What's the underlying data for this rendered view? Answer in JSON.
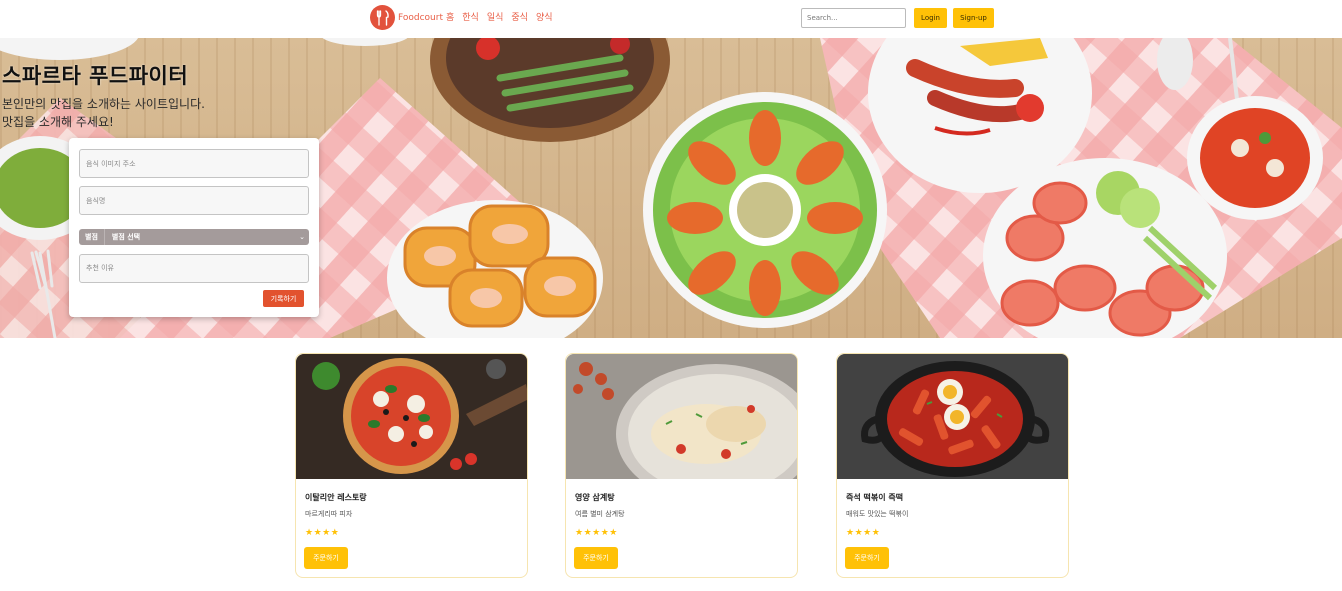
{
  "navbar": {
    "brand": "Foodcourt",
    "links": [
      "홈",
      "한식",
      "일식",
      "중식",
      "양식"
    ],
    "search_placeholder": "Search...",
    "login_label": "Login",
    "signup_label": "Sign-up"
  },
  "hero": {
    "title": "스파르타 푸드파이터",
    "subtitle_line1": "본인만의 맛집을 소개하는 사이트입니다.",
    "subtitle_line2": "맛집을 소개해 주세요!"
  },
  "form": {
    "image_placeholder": "음식 이미지 주소",
    "name_placeholder": "음식명",
    "select_prefix": "별점",
    "select_value": "별점 선택",
    "reason_placeholder": "추천 이유",
    "submit_label": "기록하기"
  },
  "cards": [
    {
      "title": "이탈리안 레스토랑",
      "desc": "마르게리따 피자",
      "stars": "★★★★",
      "rating": 4,
      "button": "주문하기"
    },
    {
      "title": "영양 삼계탕",
      "desc": "여름 별미 삼계탕",
      "stars": "★★★★★",
      "rating": 5,
      "button": "주문하기"
    },
    {
      "title": "즉석 떡볶이 즉떡",
      "desc": "매워도 맛있는 떡볶이",
      "stars": "★★★★",
      "rating": 4,
      "button": "주문하기"
    }
  ]
}
